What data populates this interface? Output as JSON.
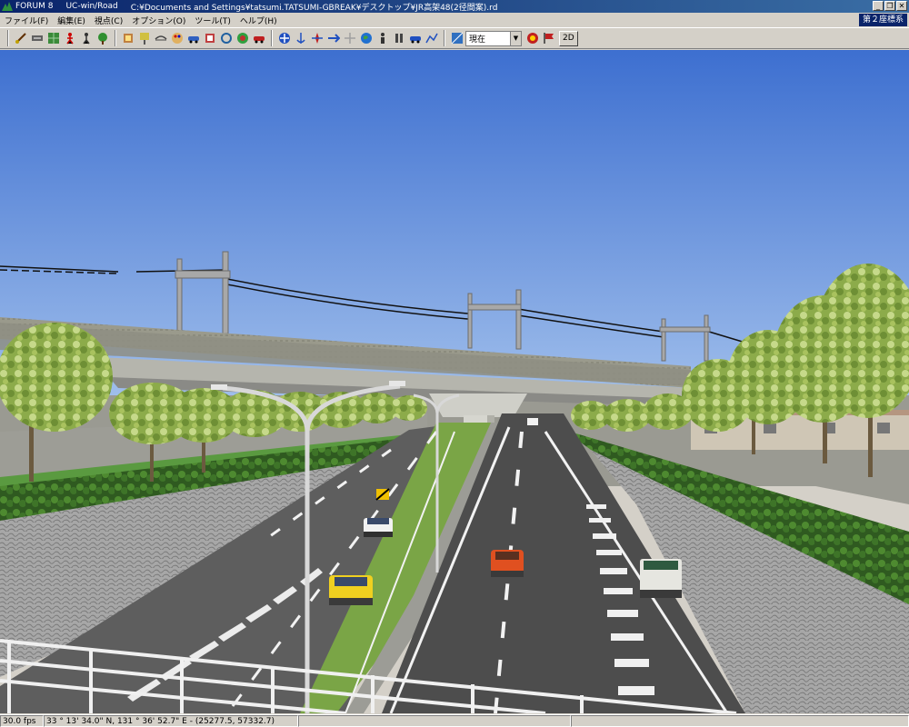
{
  "titlebar": {
    "app": "FORUM 8",
    "product": "UC-win/Road",
    "path": "C:¥Documents and Settings¥tatsumi.TATSUMI-GBREAK¥デスクトップ¥JR高架48(2径間案).rd",
    "minimize": "_",
    "restore": "❐",
    "close": "✕"
  },
  "menu": {
    "items": [
      "ファイル(F)",
      "編集(E)",
      "視点(C)",
      "オプション(O)",
      "ツール(T)",
      "ヘルプ(H)"
    ],
    "coord_system": "第２座標系"
  },
  "toolbar": {
    "time_select": "現在",
    "view_2d": "2D"
  },
  "status": {
    "fps": "30.0 fps",
    "lat": "33 °  13' 34.0\" N, 131 °  36' 52.7\" E  -  (25277.5, 57332.7)",
    "empty1": "",
    "empty2": ""
  }
}
